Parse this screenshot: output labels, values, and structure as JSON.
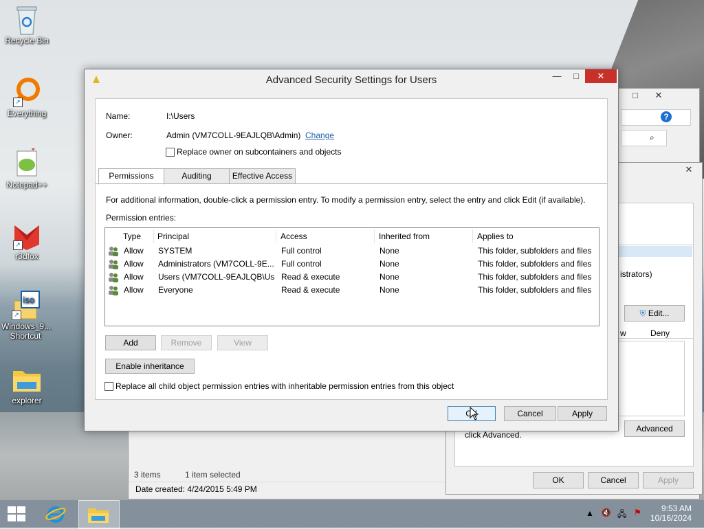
{
  "desktop": {
    "icons": [
      {
        "label": "Recycle Bin"
      },
      {
        "label": "Everything"
      },
      {
        "label": "Notepad++"
      },
      {
        "label": "r3dfox"
      },
      {
        "label": "Windows_9...\nShortcut"
      },
      {
        "label": "explorer"
      }
    ]
  },
  "background_window": {
    "edit_label": "Edit...",
    "col_allow_partial": "w",
    "col_deny": "Deny",
    "principal_partial": "istrators)",
    "advanced_hint": "click Advanced.",
    "advanced_label": "Advanced",
    "ok_label": "OK",
    "cancel_label": "Cancel",
    "apply_label": "Apply",
    "status_items": "3 items",
    "status_selected": "1 item selected",
    "date_created": "Date created: 4/24/2015 5:49 PM"
  },
  "dialog": {
    "title": "Advanced Security Settings for Users",
    "name_label": "Name:",
    "name_value": "I:\\Users",
    "owner_label": "Owner:",
    "owner_value": "Admin (VM7COLL-9EAJLQB\\Admin)",
    "change_link": "Change",
    "replace_owner_label": "Replace owner on subcontainers and objects",
    "tabs": [
      "Permissions",
      "Auditing",
      "Effective Access"
    ],
    "info_text": "For additional information, double-click a permission entry. To modify a permission entry, select the entry and click Edit (if available).",
    "entries_label": "Permission entries:",
    "columns": [
      "Type",
      "Principal",
      "Access",
      "Inherited from",
      "Applies to"
    ],
    "entries": [
      {
        "type": "Allow",
        "principal": "SYSTEM",
        "access": "Full control",
        "inherited": "None",
        "applies": "This folder, subfolders and files"
      },
      {
        "type": "Allow",
        "principal": "Administrators (VM7COLL-9E...",
        "access": "Full control",
        "inherited": "None",
        "applies": "This folder, subfolders and files"
      },
      {
        "type": "Allow",
        "principal": "Users (VM7COLL-9EAJLQB\\Us...",
        "access": "Read & execute",
        "inherited": "None",
        "applies": "This folder, subfolders and files"
      },
      {
        "type": "Allow",
        "principal": "Everyone",
        "access": "Read & execute",
        "inherited": "None",
        "applies": "This folder, subfolders and files"
      }
    ],
    "add_label": "Add",
    "remove_label": "Remove",
    "view_label": "View",
    "enable_inheritance_label": "Enable inheritance",
    "replace_child_label": "Replace all child object permission entries with inheritable permission entries from this object",
    "ok_label": "OK",
    "cancel_label": "Cancel",
    "apply_label": "Apply"
  },
  "taskbar": {
    "time": "9:53 AM",
    "date": "10/16/2024"
  }
}
